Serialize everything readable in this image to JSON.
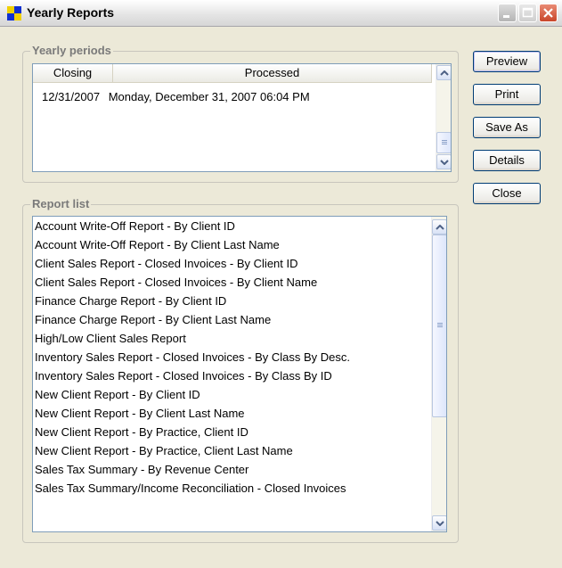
{
  "window": {
    "title": "Yearly Reports"
  },
  "yearly_periods": {
    "label": "Yearly periods",
    "columns": [
      "Closing",
      "Processed"
    ],
    "rows": [
      {
        "closing": "12/31/2007",
        "processed": "Monday, December 31, 2007 06:04 PM"
      }
    ]
  },
  "report_list": {
    "label": "Report list",
    "items": [
      "Account Write-Off Report - By Client ID",
      "Account Write-Off Report - By Client Last Name",
      "Client Sales Report - Closed Invoices - By Client ID",
      "Client Sales Report - Closed Invoices - By Client Name",
      "Finance Charge Report - By Client ID",
      "Finance Charge Report - By Client Last Name",
      "High/Low Client Sales Report",
      "Inventory Sales Report - Closed Invoices - By Class By Desc.",
      "Inventory Sales Report - Closed Invoices - By Class By ID",
      "New Client Report - By Client ID",
      "New Client Report - By Client Last Name",
      "New Client Report - By Practice, Client ID",
      "New Client Report - By Practice, Client Last Name",
      "Sales Tax Summary - By Revenue Center",
      "Sales Tax Summary/Income Reconciliation - Closed Invoices"
    ]
  },
  "buttons": {
    "preview": "Preview",
    "print": "Print",
    "save_as": "Save As",
    "details": "Details",
    "close": "Close"
  }
}
